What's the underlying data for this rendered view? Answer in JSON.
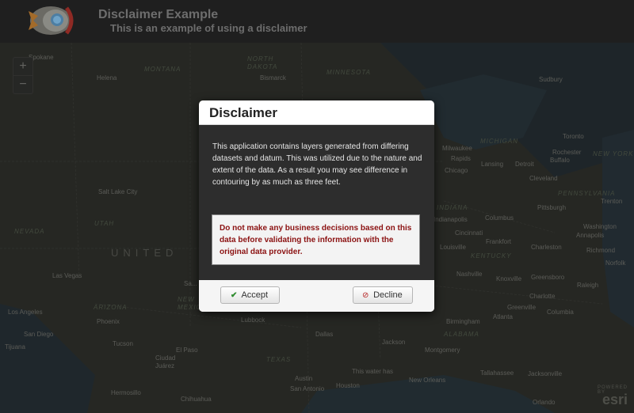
{
  "header": {
    "title": "Disclaimer Example",
    "subtitle": "This is an example of using a disclaimer",
    "logo_icon": "rocket-logo-icon"
  },
  "zoom": {
    "in_label": "+",
    "out_label": "−"
  },
  "map": {
    "labels": {
      "helena": "Helena",
      "bismarck": "Bismarck",
      "north_dakota": "NORTH\nDAKOTA",
      "montana": "MONTANA",
      "minnesota": "MINNESOTA",
      "michigan": "MICHIGAN",
      "sudbury": "Sudbury",
      "toronto": "Toronto",
      "rochester": "Rochester",
      "new_york": "NEW YORK",
      "buffalo": "Buffalo",
      "milwaukee": "Milwaukee",
      "rapids": "Rapids",
      "lansing": "Lansing",
      "detroit": "Detroit",
      "chicago": "Chicago",
      "cleveland": "Cleveland",
      "pennsylvania": "PENNSYLVANIA",
      "pittsburgh": "Pittsburgh",
      "trenton": "Trenton",
      "salt_lake": "Salt Lake City",
      "nevada": "NEVADA",
      "utah": "UTAH",
      "united": "UNITED",
      "indianapolis": "Indianapolis",
      "columbus": "Columbus",
      "indiana": "INDIANA",
      "cincinnati": "Cincinnati",
      "washington": "Washington",
      "annapolis": "Annapolis",
      "frankfort": "Frankfort",
      "louisville": "Louisville",
      "kentucky": "KENTUCKY",
      "charleston": "Charleston",
      "richmond": "Richmond",
      "norfolk": "Norfolk",
      "las_vegas": "Las Vegas",
      "nashville": "Nashville",
      "knoxville": "Knoxville",
      "greensboro": "Greensboro",
      "raleigh": "Raleigh",
      "los_angeles": "Los Angeles",
      "arizona": "ARIZONA",
      "phoenix": "Phoenix",
      "san_diego": "San Diego",
      "tijuana": "Tijuana",
      "tucson": "Tucson",
      "el_paso": "El Paso",
      "ciudad_juarez": "Ciudad\nJuárez",
      "lubbock": "Lubbock",
      "dallas": "Dallas",
      "texas": "TEXAS",
      "birmingham": "Birmingham",
      "atlanta": "Atlanta",
      "greenville": "Greenville",
      "charlotte": "Charlotte",
      "columbia": "Columbia",
      "jackson": "Jackson",
      "montgomery": "Montgomery",
      "alabama": "ALABAMA",
      "tallahassee": "Tallahassee",
      "jacksonville": "Jacksonville",
      "this_water": "This water has",
      "new_orleans": "New Orleans",
      "houston": "Houston",
      "austin": "Austin",
      "san_antonio": "San Antonio",
      "hermosillo": "Hermosillo",
      "chihuahua": "Chihuahua",
      "orlando": "Orlando",
      "spokane": "Spokane",
      "santa_fe": "Sa...",
      "new_mexico": "NEW\nMEXICO"
    }
  },
  "attribution": {
    "powered": "POWERED BY",
    "brand": "esri"
  },
  "dialog": {
    "title": "Disclaimer",
    "body": "This application contains layers generated from differing datasets and datum. This was utilized due to the nature and extent of the data. As a result you may see difference in contouring by as much as three feet.",
    "warning": "Do not make any business decisions based on this data before validating the information with the original data provider.",
    "accept_label": "Accept",
    "decline_label": "Decline"
  }
}
